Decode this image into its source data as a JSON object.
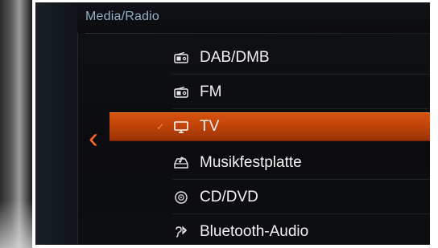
{
  "header": {
    "title": "Media/Radio"
  },
  "menu": {
    "items": [
      {
        "label": "DAB/DMB",
        "icon": "radio-icon",
        "selected": false
      },
      {
        "label": "FM",
        "icon": "radio-icon",
        "selected": false
      },
      {
        "label": "TV",
        "icon": "tv-icon",
        "selected": true
      },
      {
        "label": "Musikfestplatte",
        "icon": "music-hdd-icon",
        "selected": false
      },
      {
        "label": "CD/DVD",
        "icon": "disc-icon",
        "selected": false
      },
      {
        "label": "Bluetooth-Audio",
        "icon": "bluetooth-audio-icon",
        "selected": false
      }
    ]
  },
  "colors": {
    "accent": "#d6520e",
    "header_text": "#8fb2c8",
    "item_text": "#f3f3f3",
    "back_arrow": "#ff6a1a"
  },
  "nav": {
    "back_icon": "chevron-left-icon",
    "selected_marker_icon": "check-icon"
  }
}
